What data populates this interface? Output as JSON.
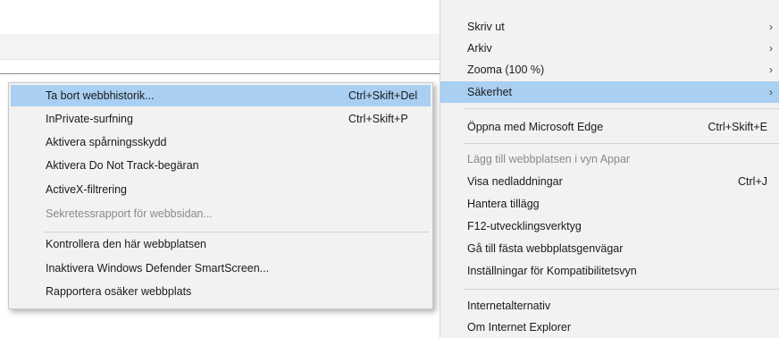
{
  "tools_menu": {
    "items": [
      {
        "label": "Skriv ut",
        "arrow": "›"
      },
      {
        "label": "Arkiv",
        "arrow": "›"
      },
      {
        "label": "Zooma (100 %)",
        "arrow": "›"
      },
      {
        "label": "Säkerhet",
        "arrow": "›"
      },
      {
        "label": "Öppna med Microsoft Edge",
        "shortcut": "Ctrl+Skift+E"
      },
      {
        "label": "Lägg till webbplatsen i vyn Appar"
      },
      {
        "label": "Visa nedladdningar",
        "shortcut": "Ctrl+J"
      },
      {
        "label": "Hantera tillägg"
      },
      {
        "label": "F12-utvecklingsverktyg"
      },
      {
        "label": "Gå till fästa webbplatsgenvägar"
      },
      {
        "label": "Inställningar för Kompatibilitetsvyn"
      },
      {
        "label": "Internetalternativ"
      },
      {
        "label": "Om Internet Explorer"
      }
    ]
  },
  "security_submenu": {
    "items": [
      {
        "label": "Ta bort webbhistorik...",
        "shortcut": "Ctrl+Skift+Del"
      },
      {
        "label": "InPrivate-surfning",
        "shortcut": "Ctrl+Skift+P"
      },
      {
        "label": "Aktivera spårningsskydd"
      },
      {
        "label": "Aktivera Do Not Track-begäran"
      },
      {
        "label": "ActiveX-filtrering"
      },
      {
        "label": "Sekretessrapport för webbsidan..."
      },
      {
        "label": "Kontrollera den här webbplatsen"
      },
      {
        "label": "Inaktivera Windows Defender SmartScreen..."
      },
      {
        "label": "Rapportera osäker webbplats"
      }
    ]
  },
  "colors": {
    "menu_bg": "#f2f2f2",
    "highlight": "#a9cff2",
    "disabled_text": "#8a8a8a"
  }
}
